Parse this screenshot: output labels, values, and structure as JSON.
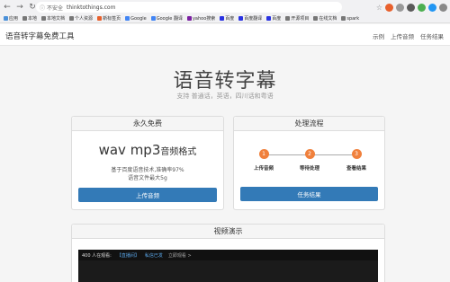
{
  "browser": {
    "insecure_label": "不安全",
    "url": "thinktothings.com",
    "back_icon": "arrow-left-icon",
    "forward_icon": "arrow-right-icon",
    "reload_icon": "reload-icon"
  },
  "bookmarks": [
    {
      "label": "应用",
      "color": "#4a90d9"
    },
    {
      "label": "本地",
      "color": "#777777"
    },
    {
      "label": "本地文档",
      "color": "#777777"
    },
    {
      "label": "个人资源",
      "color": "#777777"
    },
    {
      "label": "新标签页",
      "color": "#e8602c"
    },
    {
      "label": "Google",
      "color": "#4285f4"
    },
    {
      "label": "Google 翻译",
      "color": "#4285f4"
    },
    {
      "label": "yahoo搜索",
      "color": "#7b1fa2"
    },
    {
      "label": "百度",
      "color": "#2932e1"
    },
    {
      "label": "百度翻译",
      "color": "#2932e1"
    },
    {
      "label": "百度",
      "color": "#2932e1"
    },
    {
      "label": "开源项目",
      "color": "#777777"
    },
    {
      "label": "在线文档",
      "color": "#777777"
    },
    {
      "label": "spark",
      "color": "#777777"
    }
  ],
  "site": {
    "brand": "语音转字幕免费工具",
    "nav": [
      "示例",
      "上传音频",
      "任务结果"
    ]
  },
  "hero": {
    "title": "语音转字幕",
    "subtitle": "支持 普通话，英语，四川话和粤语"
  },
  "free_panel": {
    "heading": "永久免费",
    "format": "wav mp3",
    "format_suffix": "音频格式",
    "line1": "基于百度语音技术,准确率97%",
    "line2": "语音文件最大5g",
    "button": "上传音频"
  },
  "flow_panel": {
    "heading": "处理流程",
    "steps": [
      {
        "num": "1",
        "label": "上传音频"
      },
      {
        "num": "2",
        "label": "等待处理"
      },
      {
        "num": "3",
        "label": "查看结果"
      }
    ],
    "button": "任务结果"
  },
  "video_panel": {
    "heading": "视频演示",
    "viewers": "400 人在观看:",
    "live_tag": "【直播间】",
    "live_link": "私信已发",
    "control": "立即观看 >"
  },
  "colors": {
    "primary": "#337ab7",
    "step": "#f0803c"
  }
}
